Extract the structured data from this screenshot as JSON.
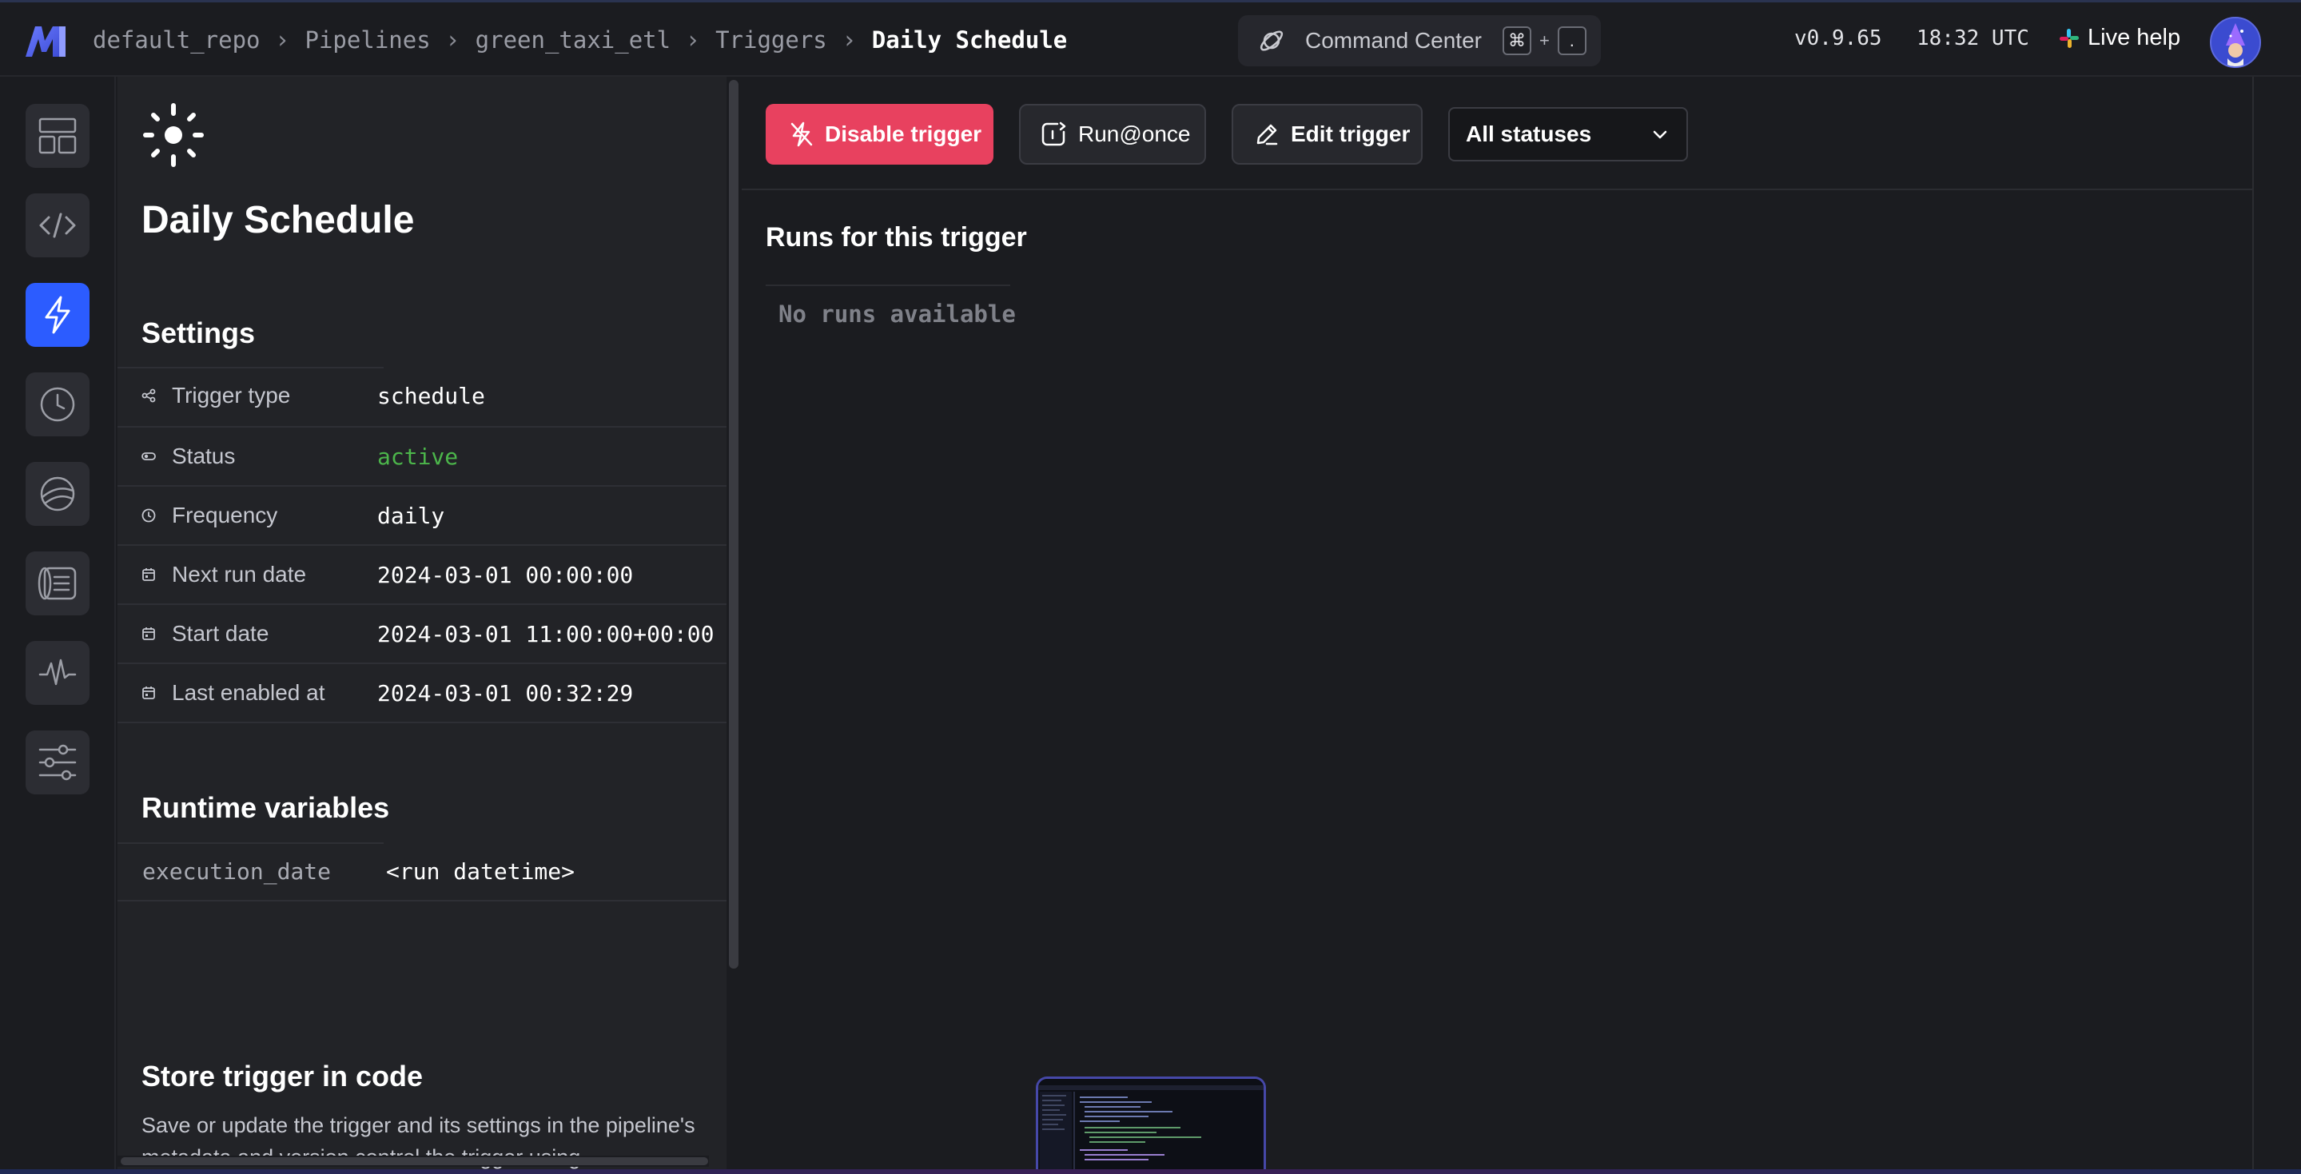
{
  "header": {
    "breadcrumbs": [
      "default_repo",
      "Pipelines",
      "green_taxi_etl",
      "Triggers"
    ],
    "current": "Daily Schedule",
    "command_center": {
      "label": "Command Center",
      "key1": "⌘",
      "plus": "+",
      "key2": "."
    },
    "version": "v0.9.65",
    "time": "18:32 UTC",
    "live_help": "Live help"
  },
  "sidebar": {
    "items": [
      {
        "icon": "layout-icon",
        "active": false
      },
      {
        "icon": "code-icon",
        "active": false
      },
      {
        "icon": "lightning-icon",
        "active": true
      },
      {
        "icon": "clock-icon",
        "active": false
      },
      {
        "icon": "globe-icon",
        "active": false
      },
      {
        "icon": "terminal-icon",
        "active": false
      },
      {
        "icon": "pulse-icon",
        "active": false
      },
      {
        "icon": "sliders-icon",
        "active": false
      }
    ]
  },
  "detail": {
    "title": "Daily Schedule",
    "settings_heading": "Settings",
    "settings": [
      {
        "icon": "share-icon",
        "label": "Trigger type",
        "value": "schedule"
      },
      {
        "icon": "toggle-icon",
        "label": "Status",
        "value": "active"
      },
      {
        "icon": "clock-icon",
        "label": "Frequency",
        "value": "daily"
      },
      {
        "icon": "calendar-icon",
        "label": "Next run date",
        "value": "2024-03-01 00:00:00"
      },
      {
        "icon": "calendar-icon",
        "label": "Start date",
        "value": "2024-03-01 11:00:00+00:00"
      },
      {
        "icon": "calendar-icon",
        "label": "Last enabled at",
        "value": "2024-03-01 00:32:29"
      }
    ],
    "runtime_heading": "Runtime variables",
    "runtime_variables": [
      {
        "name": "execution_date",
        "value": "<run datetime>"
      }
    ],
    "store_heading": "Store trigger in code",
    "store_description": "Save or update the trigger and its settings in the pipeline's metadata and version control the trigger using"
  },
  "toolbar": {
    "disable_label": "Disable trigger",
    "run_label": "Run@once",
    "edit_label": "Edit trigger",
    "status_filter": "All statuses"
  },
  "runs": {
    "heading": "Runs for this trigger",
    "empty": "No runs available"
  },
  "colors": {
    "accent": "#2c5cff",
    "danger": "#e8415f",
    "active_status": "#4cb64b",
    "background": "#1b1c20",
    "panel": "#222327"
  }
}
